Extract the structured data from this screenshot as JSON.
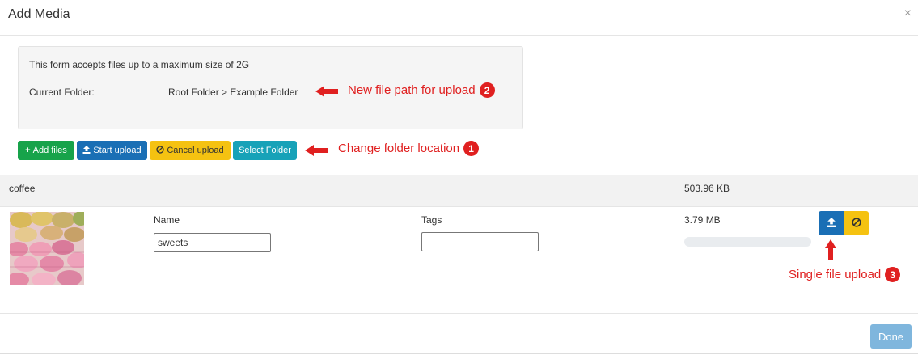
{
  "dialog": {
    "title": "Add Media",
    "close_glyph": "×"
  },
  "info": {
    "max_size_text": "This form accepts files up to a maximum size of 2G",
    "current_folder_label": "Current Folder:",
    "current_folder_path": "Root Folder > Example Folder"
  },
  "toolbar": {
    "add_files": "Add files",
    "start_upload": "Start upload",
    "cancel_upload": "Cancel upload",
    "select_folder": "Select Folder",
    "add_icon": "plus-icon",
    "upload_icon": "upload-icon",
    "cancel_icon": "ban-icon"
  },
  "annotations": {
    "path": {
      "text": "New file path for upload",
      "number": "2"
    },
    "folder": {
      "text": "Change folder location",
      "number": "1"
    },
    "single": {
      "text": "Single file upload",
      "number": "3"
    }
  },
  "file_group": {
    "name": "coffee",
    "total_size": "503.96 KB"
  },
  "file_item": {
    "name_label": "Name",
    "name_value": "sweets",
    "tags_label": "Tags",
    "tags_value": "",
    "size": "3.79 MB",
    "progress": 0,
    "thumbnail": "macarons-image"
  },
  "footer": {
    "done": "Done"
  },
  "colors": {
    "accent_blue": "#1a6fb5",
    "success_green": "#17a34a",
    "warning_yellow": "#f5c211",
    "info_teal": "#17a2b8",
    "annotation_red": "#e02020",
    "done_disabled": "#7fb6dd"
  }
}
